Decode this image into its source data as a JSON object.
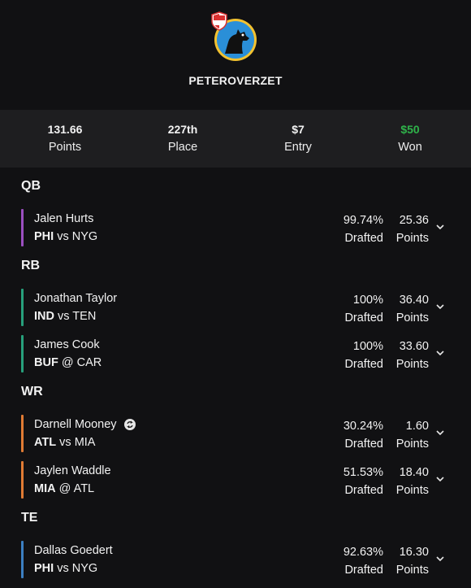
{
  "profile": {
    "username": "PETEROVERZET"
  },
  "stats": {
    "points": {
      "value": "131.66",
      "label": "Points"
    },
    "place": {
      "value": "227th",
      "label": "Place"
    },
    "entry": {
      "value": "$7",
      "label": "Entry"
    },
    "won": {
      "value": "$50",
      "label": "Won"
    }
  },
  "colors": {
    "qb": "#9b4fc0",
    "rb": "#27a07c",
    "wr": "#e07b34",
    "te": "#3c7fc2",
    "won": "#2fb34a"
  },
  "sections": [
    {
      "title": "QB",
      "players": [
        {
          "name": "Jalen Hurts",
          "team": "PHI",
          "sep": "vs",
          "opp": "NYG",
          "drafted": "99.74%",
          "drafted_label": "Drafted",
          "points": "25.36",
          "points_label": "Points"
        }
      ]
    },
    {
      "title": "RB",
      "players": [
        {
          "name": "Jonathan Taylor",
          "team": "IND",
          "sep": "vs",
          "opp": "TEN",
          "drafted": "100%",
          "drafted_label": "Drafted",
          "points": "36.40",
          "points_label": "Points"
        },
        {
          "name": "James Cook",
          "team": "BUF",
          "sep": "@",
          "opp": "CAR",
          "drafted": "100%",
          "drafted_label": "Drafted",
          "points": "33.60",
          "points_label": "Points"
        }
      ]
    },
    {
      "title": "WR",
      "players": [
        {
          "name": "Darnell Mooney",
          "team": "ATL",
          "sep": "vs",
          "opp": "MIA",
          "drafted": "30.24%",
          "drafted_label": "Drafted",
          "points": "1.60",
          "points_label": "Points"
        },
        {
          "name": "Jaylen Waddle",
          "team": "MIA",
          "sep": "@",
          "opp": "ATL",
          "drafted": "51.53%",
          "drafted_label": "Drafted",
          "points": "18.40",
          "points_label": "Points"
        }
      ]
    },
    {
      "title": "TE",
      "players": [
        {
          "name": "Dallas Goedert",
          "team": "PHI",
          "sep": "vs",
          "opp": "NYG",
          "drafted": "92.63%",
          "drafted_label": "Drafted",
          "points": "16.30",
          "points_label": "Points"
        }
      ]
    }
  ]
}
